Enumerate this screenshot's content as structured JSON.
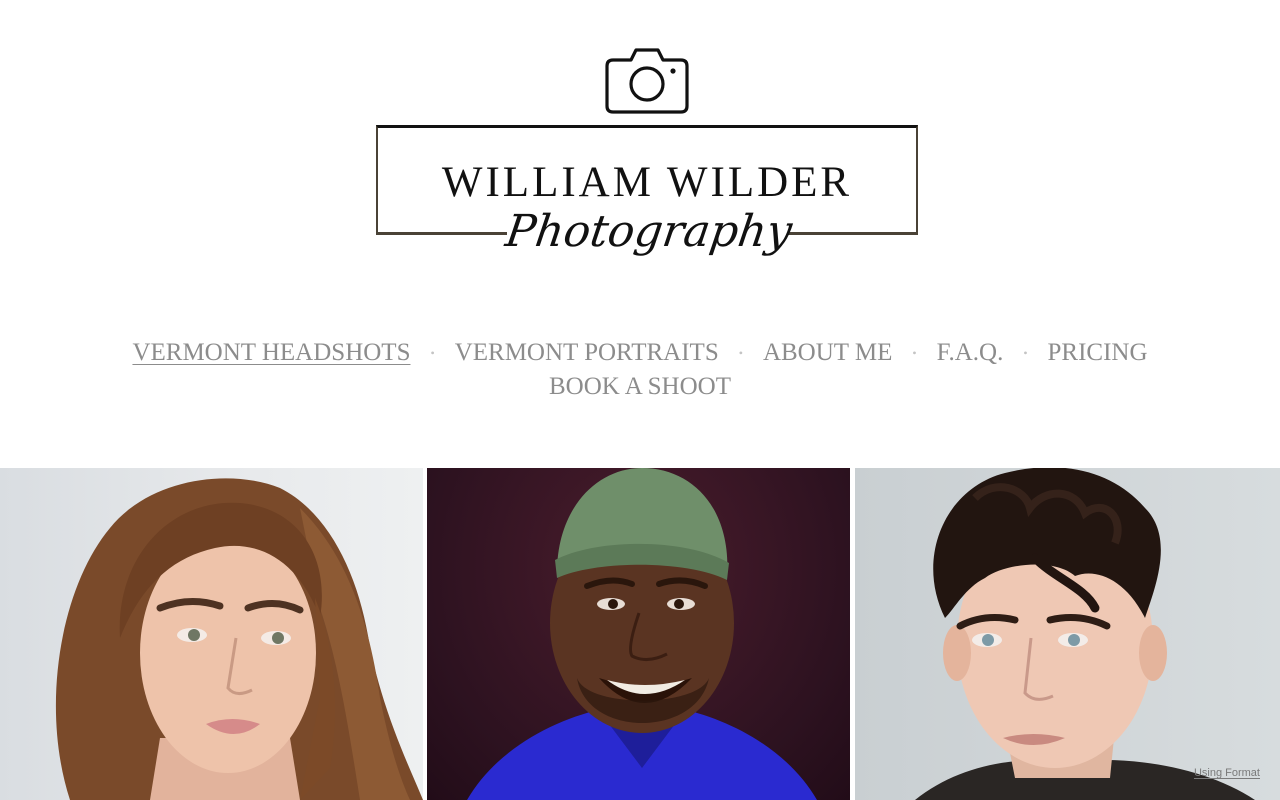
{
  "logo": {
    "name": "WILLIAM WILDER",
    "script": "Photography",
    "icon": "camera-icon"
  },
  "nav": {
    "items": [
      {
        "label": "VERMONT HEADSHOTS",
        "active": true
      },
      {
        "label": "VERMONT PORTRAITS",
        "active": false
      },
      {
        "label": "ABOUT ME",
        "active": false
      },
      {
        "label": "F.A.Q.",
        "active": false
      },
      {
        "label": "PRICING",
        "active": false
      },
      {
        "label": "BOOK A SHOOT",
        "active": false
      }
    ],
    "separator": "•"
  },
  "gallery": {
    "photos": [
      {
        "subject": "woman-headshot",
        "background": "#e3e6e8"
      },
      {
        "subject": "man-green-beanie-headshot",
        "background": "#2d1220"
      },
      {
        "subject": "man-curly-hair-headshot",
        "background": "#d2d7d9"
      }
    ]
  },
  "footer": {
    "credit": "Using Format"
  },
  "colors": {
    "nav_text": "#8c8c8c",
    "separator": "#c4c4c4",
    "logo_ink": "#111111",
    "logo_frame": "#4a4236"
  }
}
